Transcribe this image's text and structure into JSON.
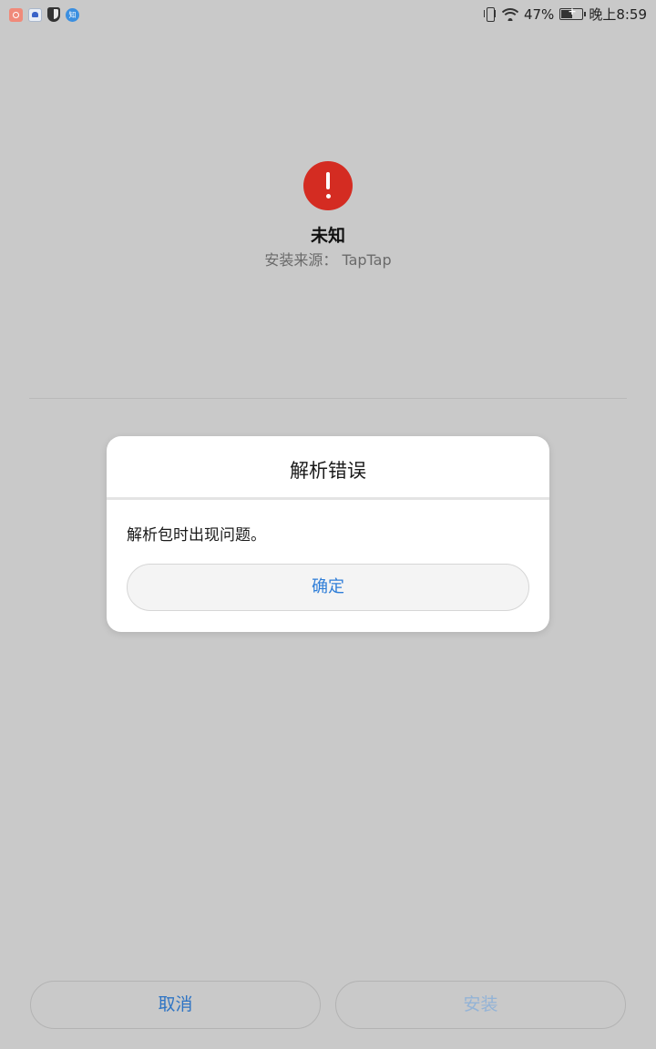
{
  "status_bar": {
    "left_icons": [
      "notification-app-icon",
      "baidu-app-icon",
      "shield-icon",
      "zhihu-app-icon"
    ],
    "zhihu_glyph": "知",
    "battery_percent": "47%",
    "time": "晚上8:59"
  },
  "app": {
    "name": "未知",
    "source": "安装来源： TapTap"
  },
  "dialog": {
    "title": "解析错误",
    "message": "解析包时出现问题。",
    "ok_label": "确定"
  },
  "bottom": {
    "cancel_label": "取消",
    "install_label": "安装"
  },
  "colors": {
    "background": "#c9c9c9",
    "error_icon": "#d42c22",
    "accent_blue": "#2e74c4",
    "disabled_blue": "#93b3d6"
  }
}
